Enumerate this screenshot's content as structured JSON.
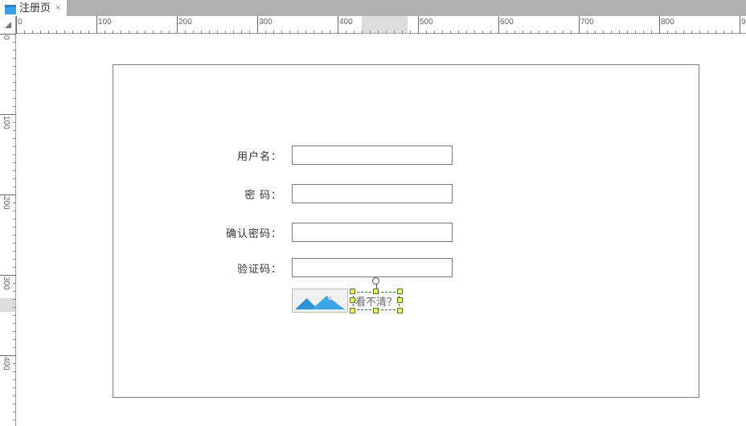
{
  "tab": {
    "title": "注册页",
    "close_glyph": "×"
  },
  "ruler": {
    "h_majors": [
      0,
      100,
      200,
      300,
      400,
      500,
      600,
      700,
      800
    ],
    "h_last_partial_label": "9",
    "v_majors": [
      0,
      100,
      200,
      300,
      400
    ],
    "minor_step": 10,
    "h_shade": {
      "from": 430,
      "to": 487
    },
    "v_shade": {
      "from": 329,
      "to": 346
    }
  },
  "form": {
    "username_label": "用户名：",
    "password_label": "密  码：",
    "confirm_label": "确认密码：",
    "captcha_label": "验证码："
  },
  "captcha": {
    "refresh_text": "看不清？"
  }
}
